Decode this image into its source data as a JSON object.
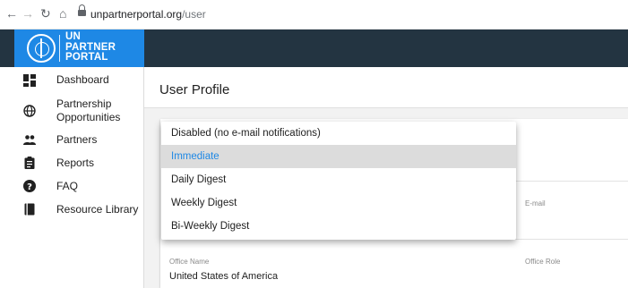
{
  "browser": {
    "url_host": "unpartnerportal.org",
    "url_path": "/user"
  },
  "brand": {
    "lines": [
      "UN",
      "PARTNER",
      "PORTAL"
    ]
  },
  "sidebar": {
    "items": [
      {
        "label": "Dashboard",
        "icon": "dashboard-icon"
      },
      {
        "label": "Partnership Opportunities",
        "icon": "globe-icon"
      },
      {
        "label": "Partners",
        "icon": "people-icon"
      },
      {
        "label": "Reports",
        "icon": "clipboard-icon"
      },
      {
        "label": "FAQ",
        "icon": "help-icon"
      },
      {
        "label": "Resource Library",
        "icon": "book-icon"
      }
    ]
  },
  "main": {
    "title": "User Profile",
    "fields": {
      "email_label": "E-mail",
      "office_name_label": "Office Name",
      "office_name_value": "United States of America",
      "office_role_label": "Office Role"
    }
  },
  "notification_dropdown": {
    "options": [
      "Disabled (no e-mail notifications)",
      "Immediate",
      "Daily Digest",
      "Weekly Digest",
      "Bi-Weekly Digest"
    ],
    "selected": "Immediate"
  },
  "colors": {
    "header_bg": "#233441",
    "brand_bg": "#1e88e5",
    "accent": "#1e88e5"
  }
}
